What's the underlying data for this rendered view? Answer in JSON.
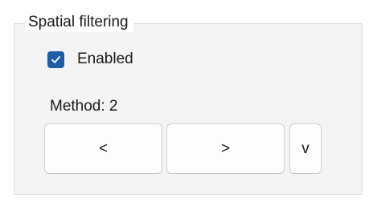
{
  "group": {
    "title": "Spatial filtering"
  },
  "enabled": {
    "label": "Enabled",
    "checked": true,
    "check_color": "#1a5ea8"
  },
  "method": {
    "label": "Method: 2"
  },
  "buttons": {
    "prev": "<",
    "next": ">",
    "dropdown": "v"
  }
}
